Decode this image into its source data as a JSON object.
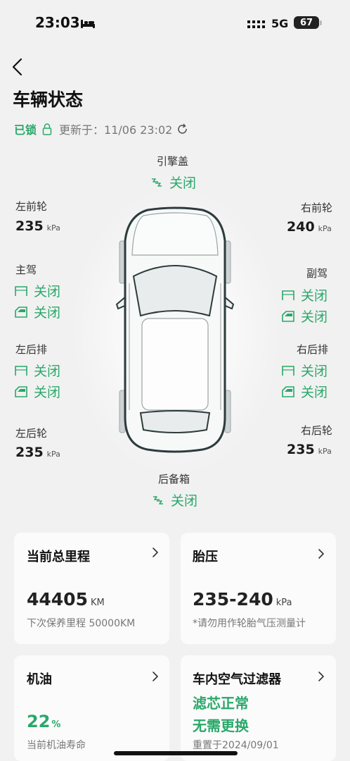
{
  "status_bar": {
    "time": "23:03",
    "network": "5G",
    "battery": "67"
  },
  "header": {
    "title": "车辆状态"
  },
  "lock": {
    "state": "已锁",
    "updated": "更新于：11/06 23:02"
  },
  "hood": {
    "label": "引擎盖",
    "status": "关闭"
  },
  "trunk": {
    "label": "后备箱",
    "status": "关闭"
  },
  "tires": {
    "front_left": {
      "label": "左前轮",
      "value": "235",
      "unit": "kPa"
    },
    "front_right": {
      "label": "右前轮",
      "value": "240",
      "unit": "kPa"
    },
    "rear_left": {
      "label": "左后轮",
      "value": "235",
      "unit": "kPa"
    },
    "rear_right": {
      "label": "右后轮",
      "value": "235",
      "unit": "kPa"
    }
  },
  "doors": {
    "driver": {
      "label": "主驾",
      "door": "关闭",
      "window": "关闭"
    },
    "passenger": {
      "label": "副驾",
      "door": "关闭",
      "window": "关闭"
    },
    "rear_left": {
      "label": "左后排",
      "door": "关闭",
      "window": "关闭"
    },
    "rear_right": {
      "label": "右后排",
      "door": "关闭",
      "window": "关闭"
    }
  },
  "cards": {
    "mileage": {
      "title": "当前总里程",
      "value": "44405",
      "unit": "KM",
      "sub": "下次保养里程 50000KM"
    },
    "tire_pressure": {
      "title": "胎压",
      "value": "235-240",
      "unit": "kPa",
      "sub": "*请勿用作轮胎气压测量计"
    },
    "oil": {
      "title": "机油",
      "value": "22",
      "unit": "%",
      "sub": "当前机油寿命"
    },
    "air_filter": {
      "title": "车内空气过滤器",
      "line1": "滤芯正常",
      "line2": "无需更换",
      "sub": "重置于2024/09/01"
    }
  },
  "colors": {
    "accent_green": "#2aa86a",
    "background": "#f1f1f1",
    "card": "#fbfbfb"
  },
  "icons": [
    "bed-icon",
    "signal-icon",
    "back-icon",
    "lock-icon",
    "refresh-icon",
    "hood-icon",
    "trunk-icon",
    "door-icon",
    "window-icon",
    "chevron-right-icon"
  ]
}
